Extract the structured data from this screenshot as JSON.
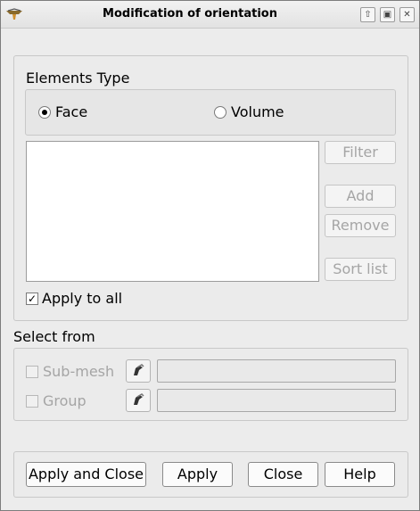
{
  "window": {
    "title": "Modification of orientation"
  },
  "elements_type": {
    "group_label": "Elements Type",
    "face_label": "Face",
    "volume_label": "Volume",
    "selected": "Face"
  },
  "list_buttons": {
    "filter": "Filter",
    "add": "Add",
    "remove": "Remove",
    "sort_list": "Sort list"
  },
  "apply_to_all": {
    "label": "Apply to all",
    "checked": true,
    "mark": "✓"
  },
  "select_from": {
    "group_label": "Select from",
    "sub_mesh_label": "Sub-mesh",
    "group_item_label": "Group",
    "sub_mesh_value": "",
    "group_value": ""
  },
  "footer": {
    "apply_close": "Apply and Close",
    "apply": "Apply",
    "close": "Close",
    "help": "Help"
  },
  "icons": {
    "app": "hammer-icon",
    "selection": "arrow-pointer-icon",
    "titlebar_buttons": [
      "shade-icon",
      "maximize-icon",
      "close-icon"
    ]
  },
  "colors": {
    "background": "#ececec",
    "disabled_text": "#a5a5a5"
  }
}
